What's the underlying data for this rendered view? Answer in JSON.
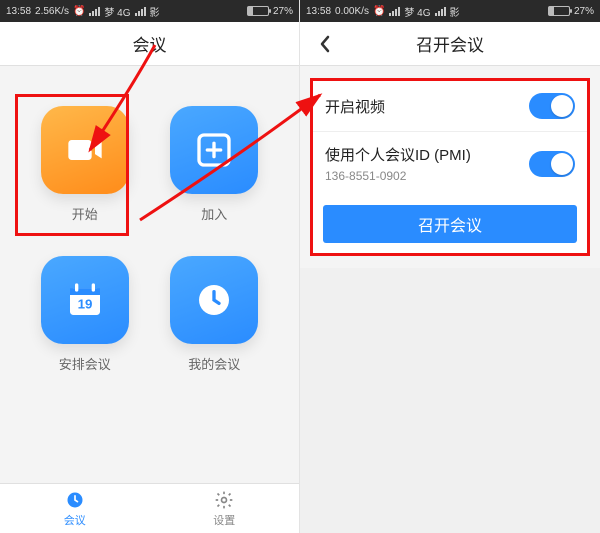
{
  "left": {
    "status": {
      "time": "13:58",
      "speed": "2.56K/s",
      "net1": "梦 4G",
      "net2": "影",
      "battery": "27%"
    },
    "title": "会议",
    "tiles": {
      "start": "开始",
      "join": "加入",
      "schedule": "安排会议",
      "mine": "我的会议"
    },
    "tabs": {
      "meet": "会议",
      "settings": "设置"
    }
  },
  "right": {
    "status": {
      "time": "13:58",
      "speed": "0.00K/s",
      "net1": "梦 4G",
      "net2": "影",
      "battery": "27%"
    },
    "title": "召开会议",
    "rows": {
      "video": "开启视频",
      "pmi": "使用个人会议ID (PMI)",
      "pmi_value": "136-8551-0902"
    },
    "cta": "召开会议"
  }
}
